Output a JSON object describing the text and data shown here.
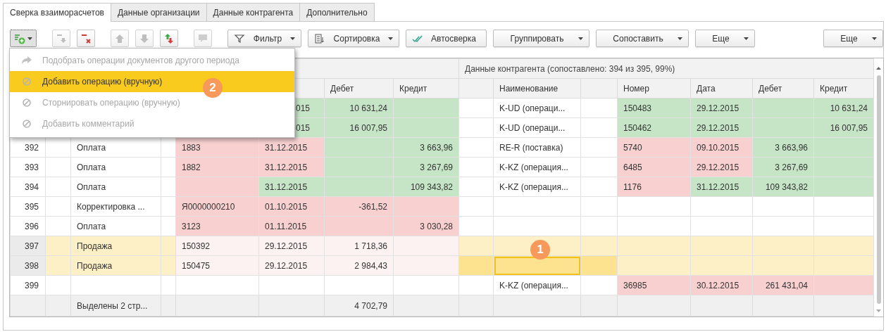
{
  "tabs": [
    {
      "label": "Сверка взаиморасчетов",
      "selected": true
    },
    {
      "label": "Данные организации",
      "selected": false
    },
    {
      "label": "Данные контрагента",
      "selected": false
    },
    {
      "label": "Дополнительно",
      "selected": false
    }
  ],
  "toolbar": [
    [
      {
        "kind": "icon",
        "dropdown": true,
        "disabled": false
      }
    ],
    [
      {
        "kind": "icon",
        "dropdown": false,
        "disabled": true
      },
      {
        "kind": "icon",
        "dropdown": false,
        "disabled": false
      }
    ],
    [
      {
        "kind": "icon",
        "dropdown": false,
        "disabled": true
      },
      {
        "kind": "icon",
        "dropdown": false,
        "disabled": true
      },
      {
        "kind": "icon",
        "dropdown": false,
        "disabled": false
      }
    ],
    [
      {
        "kind": "icon",
        "dropdown": false,
        "disabled": true
      }
    ],
    [
      {
        "kind": "text",
        "label": "Фильтр",
        "dropdown": true
      },
      {
        "kind": "text",
        "label": "Сортировка",
        "dropdown": true
      },
      {
        "kind": "text",
        "label": "Автосверка",
        "dropdown": false
      },
      {
        "kind": "text",
        "label": "Группировать",
        "dropdown": true
      },
      {
        "kind": "text",
        "label": "Сопоставить",
        "dropdown": true
      },
      {
        "kind": "text",
        "label": "Еще",
        "dropdown": true
      }
    ]
  ],
  "toolbar_right": {
    "label": "Еще",
    "dropdown": true
  },
  "menu": [
    {
      "kind": "arrow",
      "label": "Подобрать операции документов другого периода",
      "disabled": true,
      "selected": false
    },
    {
      "kind": "forbid",
      "label": "Добавить операцию (вручную)",
      "disabled": false,
      "selected": true
    },
    {
      "kind": "forbid",
      "label": "Сторнировать операцию (вручную)",
      "disabled": true,
      "selected": false
    },
    {
      "kind": "forbid",
      "label": "Добавить комментарий",
      "disabled": true,
      "selected": false
    }
  ],
  "table": {
    "group_header_right": "Данные контрагента (сопоставлено: 394 из 395, 99%)",
    "header_left": {
      "debit": "Дебет",
      "credit": "Кредит"
    },
    "header_right": {
      "name": "Наименование",
      "number": "Номер",
      "date": "Дата",
      "debit": "Дебет",
      "credit": "Кредит"
    },
    "rows": [
      {
        "covered": true,
        "left": {
          "date": {
            "text": "015",
            "color": "#c6e5c7"
          },
          "debit": {
            "text": "10 631,24",
            "color": "#c6e5c7"
          },
          "credit": {
            "color": "#c6e5c7"
          }
        },
        "right": {
          "name": {
            "text": "K-UD (операци..."
          },
          "number": {
            "text": "150483",
            "color": "#c6e5c7"
          },
          "date": {
            "text": "29.12.2015",
            "color": "#c6e5c7"
          },
          "debit": {
            "color": "#c6e5c7"
          },
          "credit": {
            "text": "10 631,24",
            "color": "#c6e5c7"
          }
        }
      },
      {
        "covered": true,
        "left": {
          "date": {
            "text": "015",
            "color": "#c6e5c7"
          },
          "debit": {
            "text": "16 007,95",
            "color": "#c6e5c7"
          },
          "credit": {
            "color": "#c6e5c7"
          }
        },
        "right": {
          "name": {
            "text": "K-UD (операци..."
          },
          "number": {
            "text": "150462",
            "color": "#c6e5c7"
          },
          "date": {
            "text": "29.12.2015",
            "color": "#c6e5c7"
          },
          "debit": {
            "color": "#c6e5c7"
          },
          "credit": {
            "text": "16 007,95",
            "color": "#c6e5c7"
          }
        }
      },
      {
        "num": "392",
        "covered": false,
        "selected": false,
        "left": {
          "name": {
            "text": "Оплата"
          },
          "number": {
            "text": "1883",
            "color": "#f8d0d0"
          },
          "date": {
            "text": "31.12.2015",
            "color": "#f8d0d0"
          },
          "debit": {
            "color": "#c6e5c7"
          },
          "credit": {
            "text": "3 663,96",
            "color": "#c6e5c7"
          }
        },
        "right": {
          "name": {
            "text": "RE-R (поставка)"
          },
          "number": {
            "text": "5740",
            "color": "#f8d0d0"
          },
          "date": {
            "text": "09.10.2015",
            "color": "#f8d0d0"
          },
          "debit": {
            "text": "3 663,96",
            "color": "#c6e5c7"
          },
          "credit": {
            "color": "#c6e5c7"
          }
        }
      },
      {
        "num": "393",
        "covered": false,
        "selected": false,
        "left": {
          "name": {
            "text": "Оплата"
          },
          "number": {
            "text": "1882",
            "color": "#f8d0d0"
          },
          "date": {
            "text": "31.12.2015",
            "color": "#f8d0d0"
          },
          "debit": {
            "color": "#c6e5c7"
          },
          "credit": {
            "text": "3 267,69",
            "color": "#c6e5c7"
          }
        },
        "right": {
          "name": {
            "text": "K-KZ (операция..."
          },
          "number": {
            "text": "6485",
            "color": "#f8d0d0"
          },
          "date": {
            "text": "29.12.2015",
            "color": "#f8d0d0"
          },
          "debit": {
            "text": "3 267,69",
            "color": "#c6e5c7"
          },
          "credit": {
            "color": "#c6e5c7"
          }
        }
      },
      {
        "num": "394",
        "covered": false,
        "selected": false,
        "left": {
          "name": {
            "text": "Оплата"
          },
          "number": {
            "color": "#f8d0d0"
          },
          "date": {
            "text": "31.12.2015",
            "color": "#c6e5c7"
          },
          "debit": {
            "color": "#c6e5c7"
          },
          "credit": {
            "text": "109 343,82",
            "color": "#c6e5c7"
          }
        },
        "right": {
          "name": {
            "text": "K-KZ (операция..."
          },
          "number": {
            "text": "1176",
            "color": "#f8d0d0"
          },
          "date": {
            "text": "31.12.2015",
            "color": "#c6e5c7"
          },
          "debit": {
            "text": "109 343,82",
            "color": "#c6e5c7"
          },
          "credit": {
            "color": "#c6e5c7"
          }
        }
      },
      {
        "num": "395",
        "covered": false,
        "selected": false,
        "left": {
          "name": {
            "text": "Корректировка ..."
          },
          "number": {
            "text": "Я0000000210",
            "color": "#f8d0d0"
          },
          "date": {
            "text": "01.10.2015",
            "color": "#f8d0d0"
          },
          "debit": {
            "text": "-361,52",
            "color": "#f8d0d0"
          },
          "credit": {
            "color": "#f8d0d0"
          }
        }
      },
      {
        "num": "396",
        "covered": false,
        "selected": false,
        "left": {
          "name": {
            "text": "Оплата"
          },
          "number": {
            "text": "3123",
            "color": "#f8d0d0"
          },
          "date": {
            "text": "01.11.2015",
            "color": "#f8d0d0"
          },
          "debit": {
            "color": "#f8d0d0"
          },
          "credit": {
            "text": "3 030,28",
            "color": "#f8d0d0"
          }
        }
      },
      {
        "num": "397",
        "covered": false,
        "selected": true,
        "left": {
          "name": {
            "text": "Продажа",
            "color": "#fdf0c6"
          },
          "number": {
            "text": "150392",
            "color": "#fdf2f2"
          },
          "date": {
            "text": "29.12.2015",
            "color": "#fdf2f2"
          },
          "debit": {
            "text": "1 718,36",
            "color": "#fdf2f2"
          },
          "credit": {
            "color": "#fdf2f2"
          }
        },
        "right": {
          "name": {
            "color": "#fdf0c6"
          },
          "number": {
            "color": "#fdf0c6"
          },
          "date": {
            "color": "#fdf0c6"
          },
          "debit": {
            "color": "#fdf0c6"
          },
          "credit": {
            "color": "#fdf0c6"
          }
        }
      },
      {
        "num": "398",
        "covered": false,
        "selected": true,
        "left": {
          "name": {
            "text": "Продажа",
            "color": "#fdf0c6"
          },
          "number": {
            "text": "150475",
            "color": "#fdf2f2"
          },
          "date": {
            "text": "29.12.2015",
            "color": "#fdf2f2"
          },
          "debit": {
            "text": "2 984,43",
            "color": "#fdf2f2"
          },
          "credit": {
            "color": "#fdf2f2"
          }
        },
        "right": {
          "name": {
            "focused": true,
            "color": "#fde28f"
          },
          "number": {
            "color": "#fdf0c6"
          },
          "date": {
            "color": "#fdf0c6"
          },
          "debit": {
            "color": "#fdf0c6"
          },
          "credit": {
            "color": "#fdf0c6"
          }
        }
      },
      {
        "num": "399",
        "covered": false,
        "selected": false,
        "right": {
          "name": {
            "text": "K-KZ (операция..."
          },
          "number": {
            "text": "36985",
            "color": "#f8d0d0"
          },
          "date": {
            "text": "30.12.2015",
            "color": "#f8d0d0"
          },
          "debit": {
            "text": "261 431,04",
            "color": "#f8d0d0"
          },
          "credit": {
            "color": "#f8d0d0"
          }
        }
      }
    ],
    "footer": {
      "name": "Выделены 2 стр...",
      "debit": "4 702,79"
    }
  },
  "markers": [
    {
      "label": "2",
      "kind": "menu"
    },
    {
      "label": "1",
      "kind": "table"
    }
  ]
}
